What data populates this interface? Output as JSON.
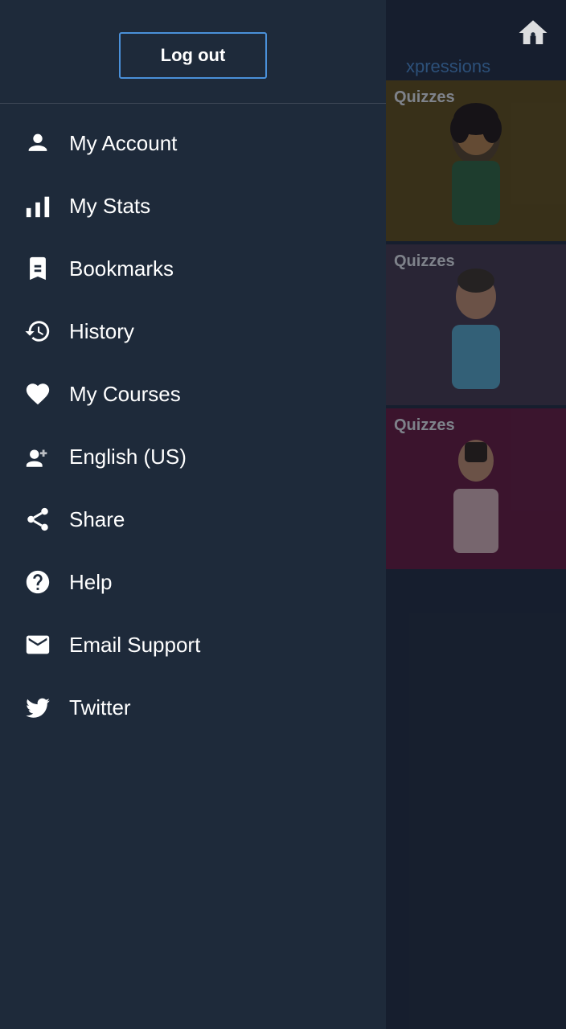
{
  "sidebar": {
    "logout_label": "Log out",
    "nav_items": [
      {
        "id": "my-account",
        "label": "My Account",
        "icon": "account"
      },
      {
        "id": "my-stats",
        "label": "My Stats",
        "icon": "stats"
      },
      {
        "id": "bookmarks",
        "label": "Bookmarks",
        "icon": "bookmarks"
      },
      {
        "id": "history",
        "label": "History",
        "icon": "history"
      },
      {
        "id": "my-courses",
        "label": "My Courses",
        "icon": "heart"
      },
      {
        "id": "english-us",
        "label": "English (US)",
        "icon": "language"
      },
      {
        "id": "share",
        "label": "Share",
        "icon": "share"
      },
      {
        "id": "help",
        "label": "Help",
        "icon": "help"
      },
      {
        "id": "email-support",
        "label": "Email Support",
        "icon": "email"
      },
      {
        "id": "twitter",
        "label": "Twitter",
        "icon": "twitter"
      }
    ]
  },
  "main": {
    "section_title": "xpressions",
    "cards": [
      {
        "id": "card-1",
        "label": "Quizzes",
        "bg": "card-1"
      },
      {
        "id": "card-2",
        "label": "Quizzes",
        "bg": "card-2"
      },
      {
        "id": "card-3",
        "label": "Quizzes",
        "bg": "card-3"
      }
    ]
  },
  "icons": {
    "account": "👤",
    "stats": "📊",
    "bookmarks": "🔖",
    "history": "🕐",
    "heart": "❤",
    "language": "🗣",
    "share": "<",
    "help": "?",
    "email": "✉",
    "twitter": "🐦",
    "home": "🏠"
  }
}
